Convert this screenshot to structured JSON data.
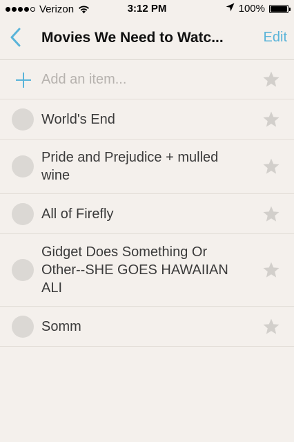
{
  "status_bar": {
    "carrier": "Verizon",
    "time": "3:12 PM",
    "battery": "100%",
    "signal_bars_filled": 4,
    "signal_bars_total": 5
  },
  "nav": {
    "title": "Movies We Need to Watc...",
    "edit_label": "Edit",
    "back_icon": "chevron-left-icon"
  },
  "add_item": {
    "placeholder": "Add an item...",
    "icon": "plus-icon"
  },
  "items": [
    {
      "text": "World's End",
      "starred": false
    },
    {
      "text": "Pride and Prejudice + mulled wine",
      "starred": false
    },
    {
      "text": "All of Firefly",
      "starred": false
    },
    {
      "text": "Gidget Does Something Or Other--SHE GOES HAWAIIAN ALI",
      "starred": false
    },
    {
      "text": "Somm",
      "starred": false
    }
  ],
  "colors": {
    "accent": "#5ab4d9",
    "background": "#f4f0ec",
    "star": "#d2cfcb",
    "checkbox": "#dbd8d4"
  }
}
